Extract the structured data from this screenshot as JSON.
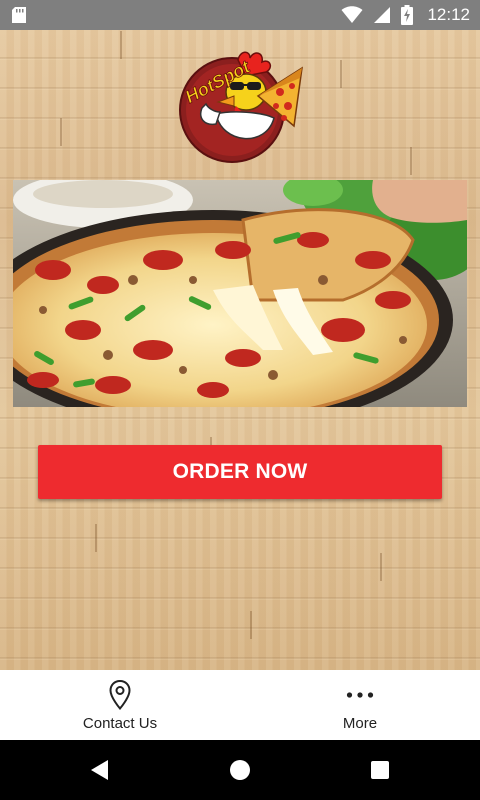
{
  "status_bar": {
    "time": "12:12",
    "icons": [
      "sd-card-icon",
      "wifi-icon",
      "cellular-signal-icon",
      "battery-charging-icon"
    ]
  },
  "logo": {
    "brand_text": "HotSpot",
    "icon": "chicken-pizza-logo"
  },
  "banner": {
    "image": "pizza-photo"
  },
  "order_button": {
    "label": "ORDER NOW",
    "color": "#ee2b2f"
  },
  "bottom_nav": {
    "items": [
      {
        "label": "Contact Us",
        "icon": "map-pin-icon"
      },
      {
        "label": "More",
        "icon": "more-dots-icon"
      }
    ]
  },
  "system_nav": {
    "buttons": [
      "back-icon",
      "home-icon",
      "recents-icon"
    ]
  },
  "colors": {
    "status_bar": "#7f7f7f",
    "accent": "#ee2b2f",
    "nav_background": "#ffffff"
  }
}
